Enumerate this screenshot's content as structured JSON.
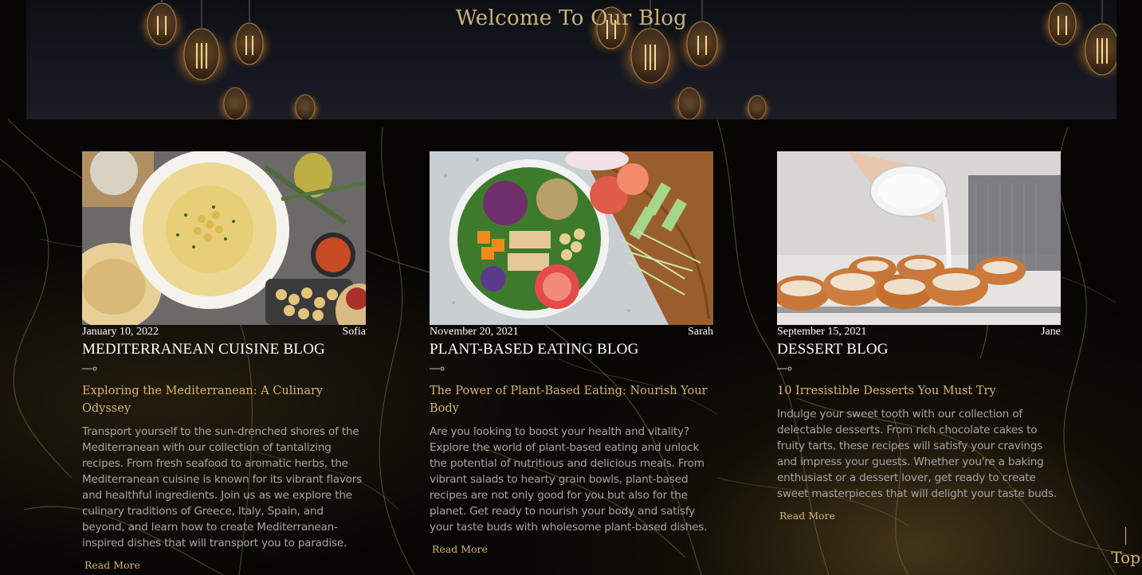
{
  "hero": {
    "title": "Welcome To Our Blog"
  },
  "colors": {
    "accent": "#d6b46a",
    "body_text": "#a5a5a5",
    "background": "#070605"
  },
  "posts": [
    {
      "date": "January 10, 2022",
      "author": "Sofia",
      "heading": "MEDITERRANEAN CUISINE BLOG",
      "title": "Exploring the Mediterranean: A Culinary Odyssey",
      "body": "Transport yourself to the sun-drenched shores of the Mediterranean with our collection of tantalizing recipes. From fresh seafood to aromatic herbs, the Mediterranean cuisine is known for its vibrant flavors and healthful ingredients. Join us as we explore the culinary traditions of Greece, Italy, Spain, and beyond, and learn how to create Mediterranean-inspired dishes that will transport you to paradise.",
      "read_more": "Read More",
      "image": "hummus-bowl-image"
    },
    {
      "date": "November 20, 2021",
      "author": "Sarah",
      "heading": "PLANT-BASED EATING BLOG",
      "title": "The Power of Plant-Based Eating: Nourish Your Body",
      "body": "Are you looking to boost your health and vitality? Explore the world of plant-based eating and unlock the potential of nutritious and delicious meals. From vibrant salads to hearty grain bowls, plant-based recipes are not only good for you but also for the planet. Get ready to nourish your body and satisfy your taste buds with wholesome plant-based dishes.",
      "read_more": "Read More",
      "image": "salad-bowl-image"
    },
    {
      "date": "September 15, 2021",
      "author": "Jane",
      "heading": "DESSERT BLOG",
      "title": "10 Irresistible Desserts You Must Try",
      "body": "Indulge your sweet tooth with our collection of delectable desserts. From rich chocolate cakes to fruity tarts, these recipes will satisfy your cravings and impress your guests. Whether you're a baking enthusiast or a dessert lover, get ready to create sweet masterpieces that will delight your taste buds.",
      "read_more": "Read More",
      "image": "glazed-donuts-image"
    }
  ],
  "top_link": "Top"
}
